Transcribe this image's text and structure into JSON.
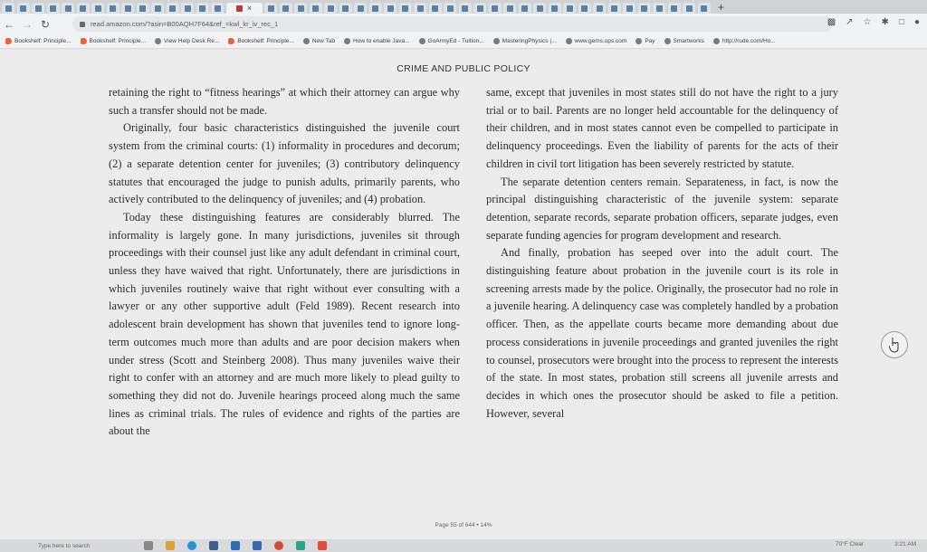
{
  "browser": {
    "tab_count": 46,
    "active_tab_index": 15,
    "url": "read.amazon.com/?asin=B00AQH7F64&ref_=kwl_kr_iv_rec_1",
    "bookmarks": [
      {
        "label": "Bookshelf: Principle...",
        "icon": "pearson-icon"
      },
      {
        "label": "Bookshelf: Principle...",
        "icon": "pearson-icon"
      },
      {
        "label": "View Help Desk Re...",
        "icon": "helpdesk-icon"
      },
      {
        "label": "Bookshelf: Principle...",
        "icon": "pearson-icon"
      },
      {
        "label": "New Tab",
        "icon": "globe-icon"
      },
      {
        "label": "How to enable Java...",
        "icon": "java-icon"
      },
      {
        "label": "GoArmyEd - Tuition...",
        "icon": "globe-icon"
      },
      {
        "label": "MasteringPhysics |...",
        "icon": "mastering-icon"
      },
      {
        "label": "www.gems.ups.com",
        "icon": "globe-icon"
      },
      {
        "label": "Pay",
        "icon": "globe-icon"
      },
      {
        "label": "Smartworks",
        "icon": "globe-icon"
      },
      {
        "label": "http://rude.com/Ho...",
        "icon": "info-icon"
      }
    ]
  },
  "document": {
    "running_head": "CRIME AND PUBLIC POLICY",
    "left_column": [
      {
        "indent": false,
        "text": "retaining the right to “fitness hearings” at which their attorney can argue why such a transfer should not be made."
      },
      {
        "indent": true,
        "text": "Originally, four basic characteristics distinguished the juvenile court system from the criminal courts: (1) informality in procedures and decorum; (2) a separate detention center for juveniles; (3) contributory delinquency statutes that encouraged the judge to punish adults, primarily parents, who actively contributed to the delinquency of juveniles; and (4) probation."
      },
      {
        "indent": true,
        "text": "Today these distinguishing features are considerably blurred. The informality is largely gone. In many jurisdictions, juveniles sit through proceedings with their counsel just like any adult defendant in criminal court, unless they have waived that right. Unfortunately, there are jurisdictions in which juveniles routinely waive that right without ever consulting with a lawyer or any other supportive adult (Feld 1989). Recent research into adolescent brain development has shown that juveniles tend to ignore long-term outcomes much more than adults and are poor decision makers when under stress (Scott and Steinberg 2008). Thus many juveniles waive their right to confer with an attorney and are much more likely to plead guilty to something they did not do. Juvenile hearings proceed along much the same lines as criminal trials. The rules of evidence and rights of the parties are about the"
      }
    ],
    "right_column": [
      {
        "indent": false,
        "text": "same, except that juveniles in most states still do not have the right to a jury trial or to bail. Parents are no longer held accountable for the delinquency of their children, and in most states cannot even be compelled to participate in delinquency proceedings. Even the liability of parents for the acts of their children in civil tort litigation has been severely restricted by statute."
      },
      {
        "indent": true,
        "text": "The separate detention centers remain. Separateness, in fact, is now the principal distinguishing characteristic of the juvenile system: separate detention, separate records, separate probation officers, separate judges, even separate funding agencies for program development and research."
      },
      {
        "indent": true,
        "text": "And finally, probation has seeped over into the adult court. The distinguishing feature about probation in the juvenile court is its role in screening arrests made by the police. Originally, the prosecutor had no role in a juvenile hearing. A delinquency case was completely handled by a probation officer. Then, as the appellate courts became more demanding about due process considerations in juvenile proceedings and granted juveniles the right to counsel, prosecutors were brought into the process to represent the interests of the state. In most states, probation still screens all juvenile arrests and decides in which ones the prosecutor should be asked to file a petition. However, several"
      }
    ],
    "page_info": "Page 55 of 644 • 14%"
  },
  "taskbar": {
    "search_text": "Type here to search",
    "weather": "70°F Clear",
    "clock": "3:21 AM"
  }
}
